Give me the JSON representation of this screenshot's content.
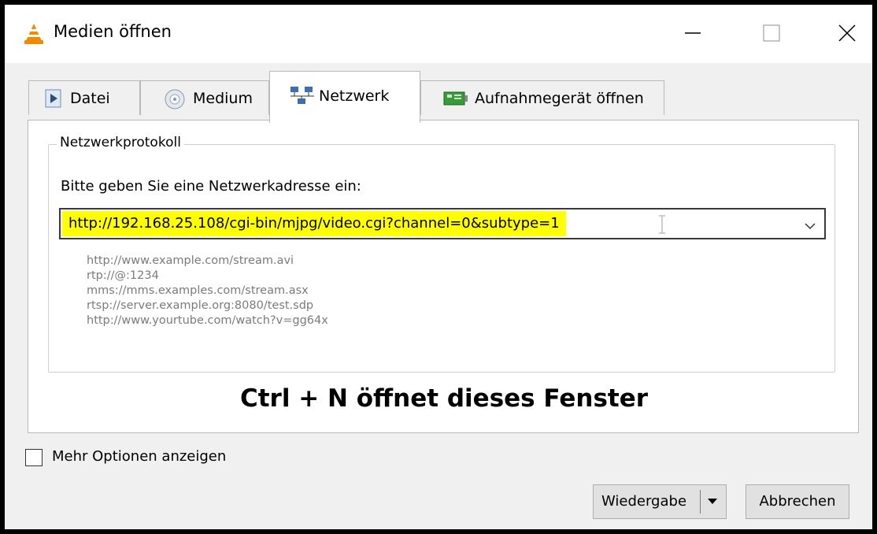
{
  "window": {
    "title": "Medien öffnen",
    "controls": {
      "minimize": "minimize-icon",
      "maximize": "maximize-icon",
      "close": "close-icon"
    }
  },
  "tabs": [
    {
      "label": "Datei",
      "icon": "file-play-icon",
      "active": false
    },
    {
      "label": "Medium",
      "icon": "disc-icon",
      "active": false
    },
    {
      "label": "Netzwerk",
      "icon": "network-icon",
      "active": true
    },
    {
      "label": "Aufnahmegerät öffnen",
      "icon": "capture-card-icon",
      "active": false
    }
  ],
  "network": {
    "group_title": "Netzwerkprotokoll",
    "prompt": "Bitte geben Sie eine Netzwerkadresse ein:",
    "address_value": "http://192.168.25.108/cgi-bin/mjpg/video.cgi?channel=0&subtype=1",
    "examples": [
      "http://www.example.com/stream.avi",
      "rtp://@:1234",
      "mms://mms.examples.com/stream.asx",
      "rtsp://server.example.org:8080/test.sdp",
      "http://www.yourtube.com/watch?v=gg64x"
    ]
  },
  "annotation": "Ctrl + N öffnet dieses Fenster",
  "options": {
    "more_options_label": "Mehr Optionen anzeigen",
    "checked": false
  },
  "buttons": {
    "play": "Wiedergabe",
    "cancel": "Abbrechen"
  },
  "colors": {
    "highlight": "#ffff00",
    "vlc_orange": "#f28a00"
  }
}
